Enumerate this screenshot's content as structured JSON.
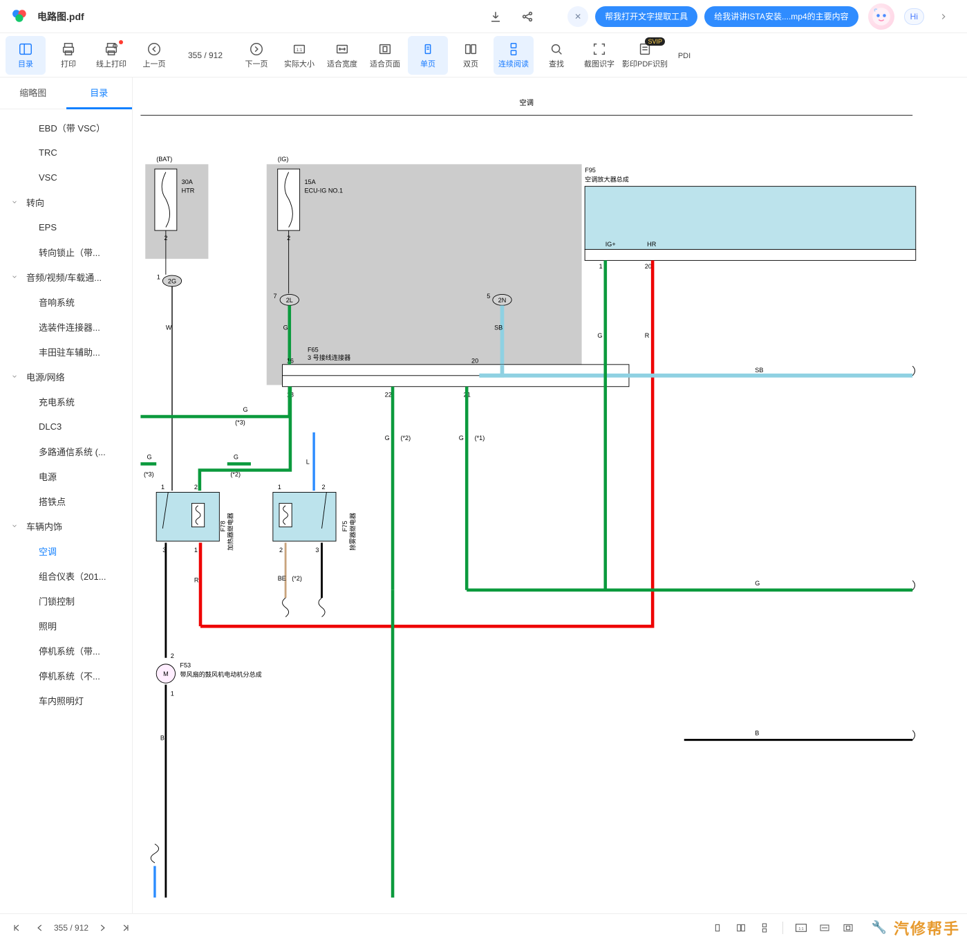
{
  "filename": "电路图.pdf",
  "hi": "Hi",
  "pills": {
    "a": "帮我打开文字提取工具",
    "b": "给我讲讲ISTA安装....mp4的主要内容"
  },
  "toolbar": {
    "toc": "目录",
    "print": "打印",
    "online_print": "线上打印",
    "prev": "上一页",
    "page": "355 / 912",
    "next": "下一页",
    "actual": "实际大小",
    "fit_w": "适合宽度",
    "fit_p": "适合页面",
    "single": "单页",
    "double": "双页",
    "cont": "连续阅读",
    "find": "查找",
    "crop_ocr": "截图识字",
    "pdf_ocr": "影印PDF识别",
    "pdi": "PDI"
  },
  "side_tabs": {
    "thumb": "缩略图",
    "toc": "目录"
  },
  "toc": [
    {
      "label": "EBD（带 VSC）",
      "level": 2
    },
    {
      "label": "TRC",
      "level": 2
    },
    {
      "label": "VSC",
      "level": 2
    },
    {
      "label": "转向",
      "level": 1
    },
    {
      "label": "EPS",
      "level": 2
    },
    {
      "label": "转向锁止（带...",
      "level": 2
    },
    {
      "label": "音频/视频/车载通...",
      "level": 1
    },
    {
      "label": "音响系统",
      "level": 2
    },
    {
      "label": "选装件连接器...",
      "level": 2
    },
    {
      "label": "丰田驻车辅助...",
      "level": 2
    },
    {
      "label": "电源/网络",
      "level": 1
    },
    {
      "label": "充电系统",
      "level": 2
    },
    {
      "label": "DLC3",
      "level": 2
    },
    {
      "label": "多路通信系统 (...",
      "level": 2
    },
    {
      "label": "电源",
      "level": 2
    },
    {
      "label": "搭铁点",
      "level": 2
    },
    {
      "label": "车辆内饰",
      "level": 1
    },
    {
      "label": "空调",
      "level": 2,
      "active": true
    },
    {
      "label": "组合仪表（201...",
      "level": 2
    },
    {
      "label": "门锁控制",
      "level": 2
    },
    {
      "label": "照明",
      "level": 2
    },
    {
      "label": "停机系统（带...",
      "level": 2
    },
    {
      "label": "停机系统（不...",
      "level": 2
    },
    {
      "label": "车内照明灯",
      "level": 2
    }
  ],
  "bottom": {
    "page": "355 / 912"
  },
  "watermark": "汽修帮手",
  "diagram": {
    "title": "空调",
    "bat": "(BAT)",
    "ig": "(IG)",
    "fuse1a": "30A",
    "fuse1b": "HTR",
    "fuse2a": "15A",
    "fuse2b": "ECU-IG NO.1",
    "f95_id": "F95",
    "f95_name": "空调放大器总成",
    "f95_pin_ig": "IG+",
    "f95_pin_hr": "HR",
    "pin_1": "1",
    "pin_2": "2",
    "pin_3": "3",
    "pin_5": "5",
    "pin_7": "7",
    "pin_16": "16",
    "pin_18": "18",
    "pin_20": "20",
    "pin_21": "21",
    "pin_22": "22",
    "conn_2g": "2G",
    "conn_2l": "2L",
    "conn_2n": "2N",
    "f65_id": "F65",
    "f65_name": "3 号接线连接器",
    "f78_id": "F78",
    "f78_name": "加热器继电器",
    "f75_id": "F75",
    "f75_name": "除雾器继电器",
    "f53_id": "F53",
    "f53_name": "带风扇的鼓风机电动机分总成",
    "wire_w": "W",
    "wire_g": "G",
    "wire_sb": "SB",
    "wire_r": "R",
    "wire_l": "L",
    "wire_be": "BE",
    "wire_b": "B",
    "note_s1": "(*1)",
    "note_s2": "(*2)",
    "note_s3": "(*3)",
    "m": "M"
  }
}
